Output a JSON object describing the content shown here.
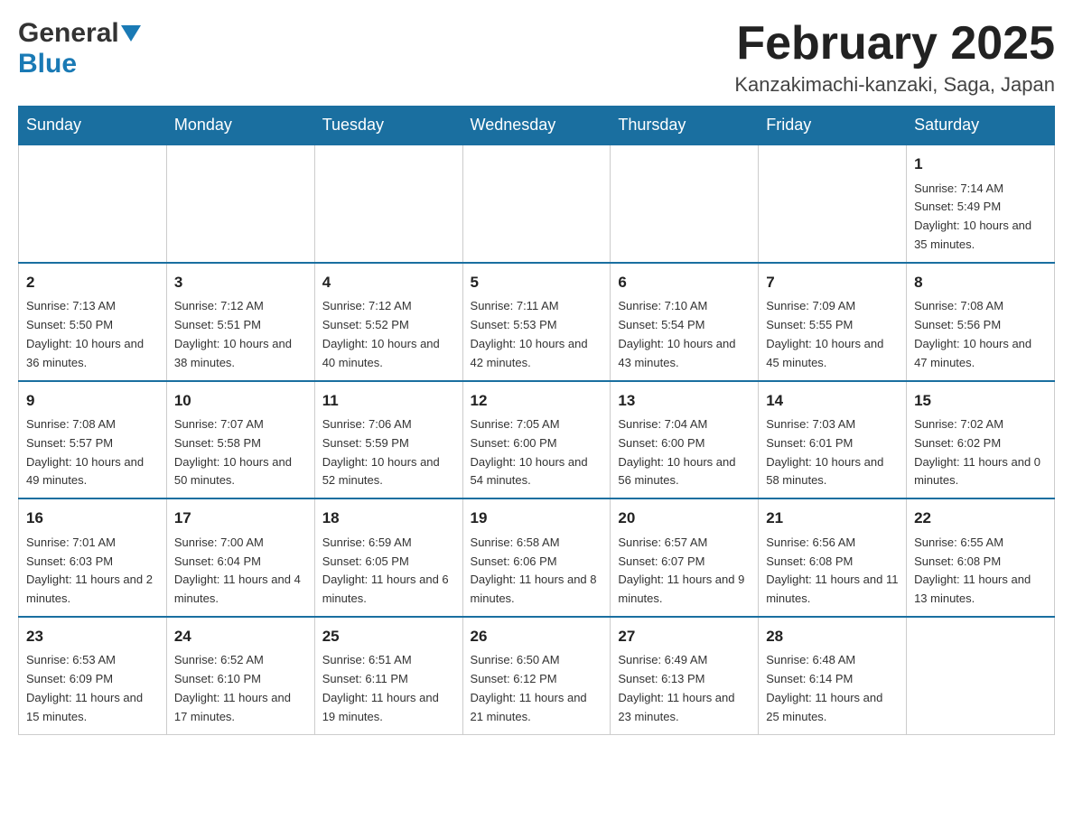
{
  "header": {
    "logo_general": "General",
    "logo_blue": "Blue",
    "month_title": "February 2025",
    "location": "Kanzakimachi-kanzaki, Saga, Japan"
  },
  "weekdays": [
    "Sunday",
    "Monday",
    "Tuesday",
    "Wednesday",
    "Thursday",
    "Friday",
    "Saturday"
  ],
  "weeks": [
    [
      {
        "day": "",
        "info": ""
      },
      {
        "day": "",
        "info": ""
      },
      {
        "day": "",
        "info": ""
      },
      {
        "day": "",
        "info": ""
      },
      {
        "day": "",
        "info": ""
      },
      {
        "day": "",
        "info": ""
      },
      {
        "day": "1",
        "info": "Sunrise: 7:14 AM\nSunset: 5:49 PM\nDaylight: 10 hours and 35 minutes."
      }
    ],
    [
      {
        "day": "2",
        "info": "Sunrise: 7:13 AM\nSunset: 5:50 PM\nDaylight: 10 hours and 36 minutes."
      },
      {
        "day": "3",
        "info": "Sunrise: 7:12 AM\nSunset: 5:51 PM\nDaylight: 10 hours and 38 minutes."
      },
      {
        "day": "4",
        "info": "Sunrise: 7:12 AM\nSunset: 5:52 PM\nDaylight: 10 hours and 40 minutes."
      },
      {
        "day": "5",
        "info": "Sunrise: 7:11 AM\nSunset: 5:53 PM\nDaylight: 10 hours and 42 minutes."
      },
      {
        "day": "6",
        "info": "Sunrise: 7:10 AM\nSunset: 5:54 PM\nDaylight: 10 hours and 43 minutes."
      },
      {
        "day": "7",
        "info": "Sunrise: 7:09 AM\nSunset: 5:55 PM\nDaylight: 10 hours and 45 minutes."
      },
      {
        "day": "8",
        "info": "Sunrise: 7:08 AM\nSunset: 5:56 PM\nDaylight: 10 hours and 47 minutes."
      }
    ],
    [
      {
        "day": "9",
        "info": "Sunrise: 7:08 AM\nSunset: 5:57 PM\nDaylight: 10 hours and 49 minutes."
      },
      {
        "day": "10",
        "info": "Sunrise: 7:07 AM\nSunset: 5:58 PM\nDaylight: 10 hours and 50 minutes."
      },
      {
        "day": "11",
        "info": "Sunrise: 7:06 AM\nSunset: 5:59 PM\nDaylight: 10 hours and 52 minutes."
      },
      {
        "day": "12",
        "info": "Sunrise: 7:05 AM\nSunset: 6:00 PM\nDaylight: 10 hours and 54 minutes."
      },
      {
        "day": "13",
        "info": "Sunrise: 7:04 AM\nSunset: 6:00 PM\nDaylight: 10 hours and 56 minutes."
      },
      {
        "day": "14",
        "info": "Sunrise: 7:03 AM\nSunset: 6:01 PM\nDaylight: 10 hours and 58 minutes."
      },
      {
        "day": "15",
        "info": "Sunrise: 7:02 AM\nSunset: 6:02 PM\nDaylight: 11 hours and 0 minutes."
      }
    ],
    [
      {
        "day": "16",
        "info": "Sunrise: 7:01 AM\nSunset: 6:03 PM\nDaylight: 11 hours and 2 minutes."
      },
      {
        "day": "17",
        "info": "Sunrise: 7:00 AM\nSunset: 6:04 PM\nDaylight: 11 hours and 4 minutes."
      },
      {
        "day": "18",
        "info": "Sunrise: 6:59 AM\nSunset: 6:05 PM\nDaylight: 11 hours and 6 minutes."
      },
      {
        "day": "19",
        "info": "Sunrise: 6:58 AM\nSunset: 6:06 PM\nDaylight: 11 hours and 8 minutes."
      },
      {
        "day": "20",
        "info": "Sunrise: 6:57 AM\nSunset: 6:07 PM\nDaylight: 11 hours and 9 minutes."
      },
      {
        "day": "21",
        "info": "Sunrise: 6:56 AM\nSunset: 6:08 PM\nDaylight: 11 hours and 11 minutes."
      },
      {
        "day": "22",
        "info": "Sunrise: 6:55 AM\nSunset: 6:08 PM\nDaylight: 11 hours and 13 minutes."
      }
    ],
    [
      {
        "day": "23",
        "info": "Sunrise: 6:53 AM\nSunset: 6:09 PM\nDaylight: 11 hours and 15 minutes."
      },
      {
        "day": "24",
        "info": "Sunrise: 6:52 AM\nSunset: 6:10 PM\nDaylight: 11 hours and 17 minutes."
      },
      {
        "day": "25",
        "info": "Sunrise: 6:51 AM\nSunset: 6:11 PM\nDaylight: 11 hours and 19 minutes."
      },
      {
        "day": "26",
        "info": "Sunrise: 6:50 AM\nSunset: 6:12 PM\nDaylight: 11 hours and 21 minutes."
      },
      {
        "day": "27",
        "info": "Sunrise: 6:49 AM\nSunset: 6:13 PM\nDaylight: 11 hours and 23 minutes."
      },
      {
        "day": "28",
        "info": "Sunrise: 6:48 AM\nSunset: 6:14 PM\nDaylight: 11 hours and 25 minutes."
      },
      {
        "day": "",
        "info": ""
      }
    ]
  ]
}
